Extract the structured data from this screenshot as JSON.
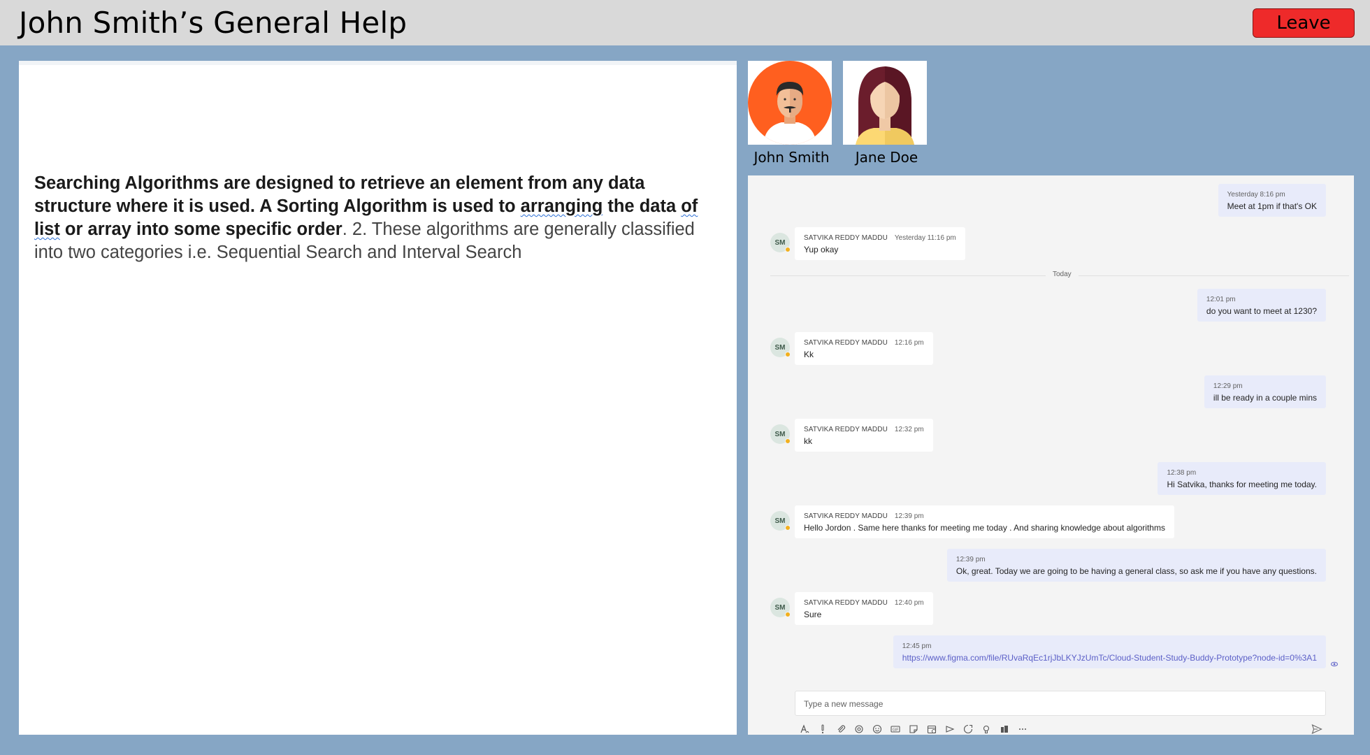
{
  "header": {
    "title": "John Smith’s General Help",
    "leave_label": "Leave",
    "leave_color": "#ee2a2a"
  },
  "document": {
    "bold_1": "Searching Algorithms are designed to retrieve an element from any data structure where it is used. A Sorting Algorithm is used to ",
    "bold_squiggle_1": "arranging",
    "bold_2": " the data ",
    "bold_squiggle_2": "of list",
    "bold_3": " or array into some specific order",
    "normal": ". 2. These algorithms are generally classified into two categories i.e. Sequential Search and Interval Search"
  },
  "participants": [
    {
      "name": "John Smith",
      "avatar_icon": "man-avatar-icon",
      "avatar_bg": "#ff5f1f"
    },
    {
      "name": "Jane Doe",
      "avatar_icon": "woman-avatar-icon"
    }
  ],
  "chat": {
    "sender_name": "SATVIKA REDDY MADDU",
    "sender_initials": "SM",
    "day_divider": "Today",
    "messages": [
      {
        "dir": "out",
        "time": "Yesterday 8:16 pm",
        "text": "Meet at 1pm if that's OK"
      },
      {
        "dir": "in",
        "time": "Yesterday 11:16 pm",
        "text": "Yup okay"
      },
      {
        "dir": "out",
        "time": "12:01 pm",
        "text": "do you want to meet at 1230?"
      },
      {
        "dir": "in",
        "time": "12:16 pm",
        "text": "Kk"
      },
      {
        "dir": "out",
        "time": "12:29 pm",
        "text": "ill be ready in a couple mins"
      },
      {
        "dir": "in",
        "time": "12:32 pm",
        "text": "kk"
      },
      {
        "dir": "out",
        "time": "12:38 pm",
        "text": "Hi Satvika, thanks for meeting me today."
      },
      {
        "dir": "in",
        "time": "12:39 pm",
        "text": "Hello Jordon . Same here thanks for meeting me today . And sharing knowledge about algorithms"
      },
      {
        "dir": "out",
        "time": "12:39 pm",
        "text": "Ok, great. Today we are going to be having a general class, so ask me if you have any questions."
      },
      {
        "dir": "in",
        "time": "12:40 pm",
        "text": "Sure"
      },
      {
        "dir": "out",
        "time": "12:45 pm",
        "text": "https://www.figma.com/file/RUvaRqEc1rjJbLKYJzUmTc/Cloud-Student-Study-Buddy-Prototype?node-id=0%3A1"
      }
    ],
    "compose_placeholder": "Type a new message",
    "toolbar_icons": [
      "format-icon",
      "important-icon",
      "attach-icon",
      "loop-icon",
      "emoji-icon",
      "gif-icon",
      "sticker-icon",
      "schedule-meeting-icon",
      "stream-icon",
      "praise-icon",
      "idea-icon",
      "approvals-icon",
      "more-options-icon"
    ],
    "send_icon": "send-icon"
  }
}
